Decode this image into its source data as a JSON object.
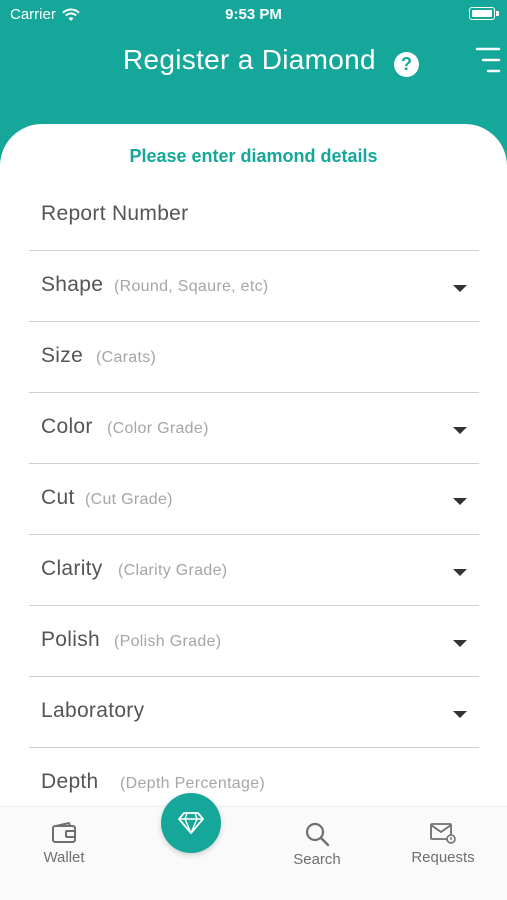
{
  "status_bar": {
    "carrier": "Carrier",
    "time": "9:53 PM"
  },
  "header": {
    "title": "Register a Diamond",
    "help_icon": "question-circle-icon",
    "menu_icon": "menu-icon"
  },
  "form": {
    "subtitle": "Please enter diamond details",
    "fields": [
      {
        "label": "Report Number",
        "hint": ""
      },
      {
        "label": "Shape",
        "hint": "(Round, Sqaure, etc)"
      },
      {
        "label": "Size",
        "hint": "(Carats)"
      },
      {
        "label": "Color",
        "hint": "(Color Grade)"
      },
      {
        "label": "Cut",
        "hint": "(Cut Grade)"
      },
      {
        "label": "Clarity",
        "hint": "(Clarity Grade)"
      },
      {
        "label": "Polish",
        "hint": "(Polish Grade)"
      },
      {
        "label": "Laboratory",
        "hint": ""
      },
      {
        "label": "Depth",
        "hint": "(Depth Percentage)"
      }
    ]
  },
  "tabbar": {
    "wallet": "Wallet",
    "search": "Search",
    "requests": "Requests",
    "center_icon": "diamond-icon"
  },
  "colors": {
    "accent": "#14a79a",
    "label": "#555555",
    "hint": "#a6a6a6",
    "divider": "#cfcfcf"
  }
}
